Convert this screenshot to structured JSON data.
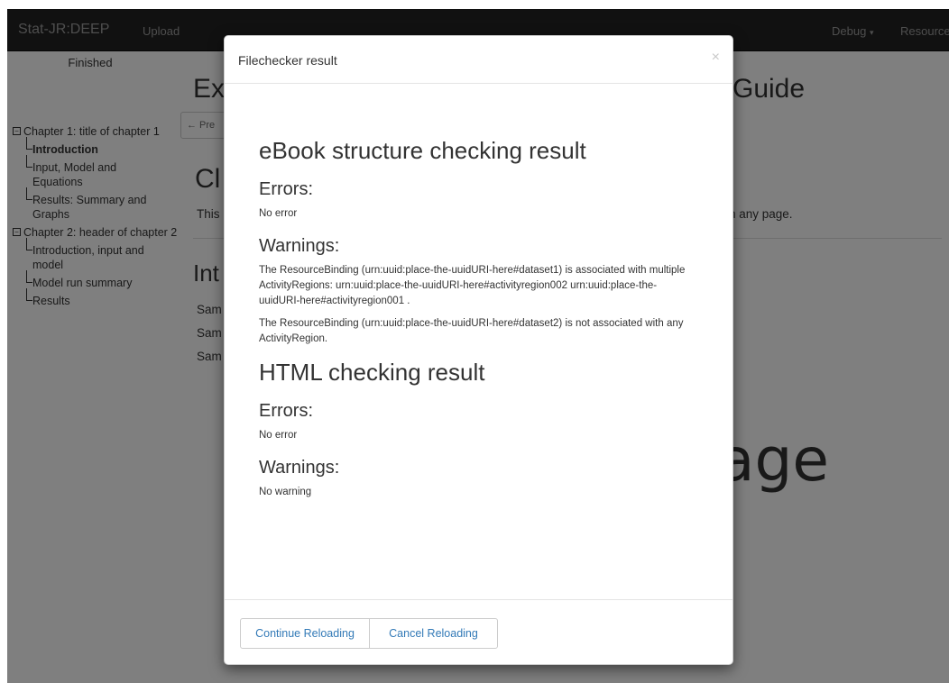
{
  "navbar": {
    "brand": "Stat-JR:DEEP",
    "upload": "Upload",
    "debug": "Debug",
    "resources": "Resources"
  },
  "sidebar": {
    "status": "Finished",
    "toc": [
      {
        "label": "Chapter 1: title of chapter 1",
        "level": "chapter"
      },
      {
        "label": "Introduction",
        "level": "section",
        "active": true
      },
      {
        "label": "Input, Model and Equations",
        "level": "section"
      },
      {
        "label": "Results: Summary and Graphs",
        "level": "section"
      },
      {
        "label": "Chapter 2: header of chapter 2",
        "level": "chapter"
      },
      {
        "label": "Introduction, input and model",
        "level": "section"
      },
      {
        "label": "Model run summary",
        "level": "section"
      },
      {
        "label": "Results",
        "level": "section"
      }
    ]
  },
  "main": {
    "title_start": "Ex",
    "title_end": "Guide",
    "prev_button": "← Pre",
    "chapter_head": "Cl",
    "chapter_line_start": "This",
    "chapter_line_end": "n any page.",
    "intro_head": "Int",
    "sample_lines": [
      "Sam",
      "Sam",
      "Sam"
    ],
    "big_word": "age"
  },
  "modal": {
    "title": "Filechecker result",
    "close": "×",
    "ebook": {
      "heading": "eBook structure checking result",
      "errors_label": "Errors:",
      "errors_text": "No error",
      "warnings_label": "Warnings:",
      "warnings": [
        "The ResourceBinding (urn:uuid:place-the-uuidURI-here#dataset1) is associated with multiple ActivityRegions: urn:uuid:place-the-uuidURI-here#activityregion002 urn:uuid:place-the-uuidURI-here#activityregion001 .",
        "The ResourceBinding (urn:uuid:place-the-uuidURI-here#dataset2) is not associated with any ActivityRegion."
      ]
    },
    "html": {
      "heading": "HTML checking result",
      "errors_label": "Errors:",
      "errors_text": "No error",
      "warnings_label": "Warnings:",
      "warnings_text": "No warning"
    },
    "footer": {
      "continue": "Continue Reloading",
      "cancel": "Cancel Reloading"
    }
  }
}
